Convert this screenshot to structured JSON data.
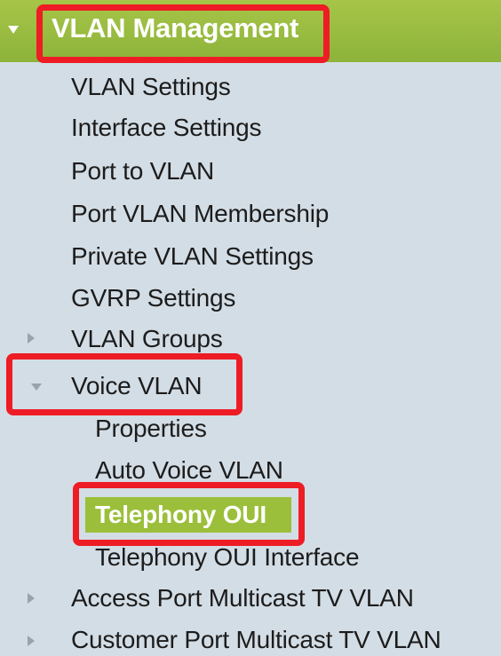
{
  "menu": {
    "header": {
      "label": "VLAN Management",
      "icon": "chevron-down-icon"
    },
    "items": [
      {
        "label": "VLAN Settings"
      },
      {
        "label": "Interface Settings"
      },
      {
        "label": "Port to VLAN"
      },
      {
        "label": "Port VLAN Membership"
      },
      {
        "label": "Private VLAN Settings"
      },
      {
        "label": "GVRP Settings"
      },
      {
        "label": "VLAN Groups",
        "icon": "chevron-right-icon"
      },
      {
        "label": "Voice VLAN",
        "icon": "chevron-down-icon"
      },
      {
        "label": "Access Port Multicast TV VLAN",
        "icon": "chevron-right-icon"
      },
      {
        "label": "Customer Port Multicast TV VLAN",
        "icon": "chevron-right-icon"
      }
    ],
    "voice_vlan_items": [
      {
        "label": "Properties"
      },
      {
        "label": "Auto Voice VLAN"
      },
      {
        "label": "Telephony OUI",
        "selected": true
      },
      {
        "label": "Telephony OUI Interface"
      }
    ]
  },
  "colors": {
    "header_green": "#9bbf3b",
    "highlight_red": "#ee1c24",
    "background": "#d3dde5"
  }
}
